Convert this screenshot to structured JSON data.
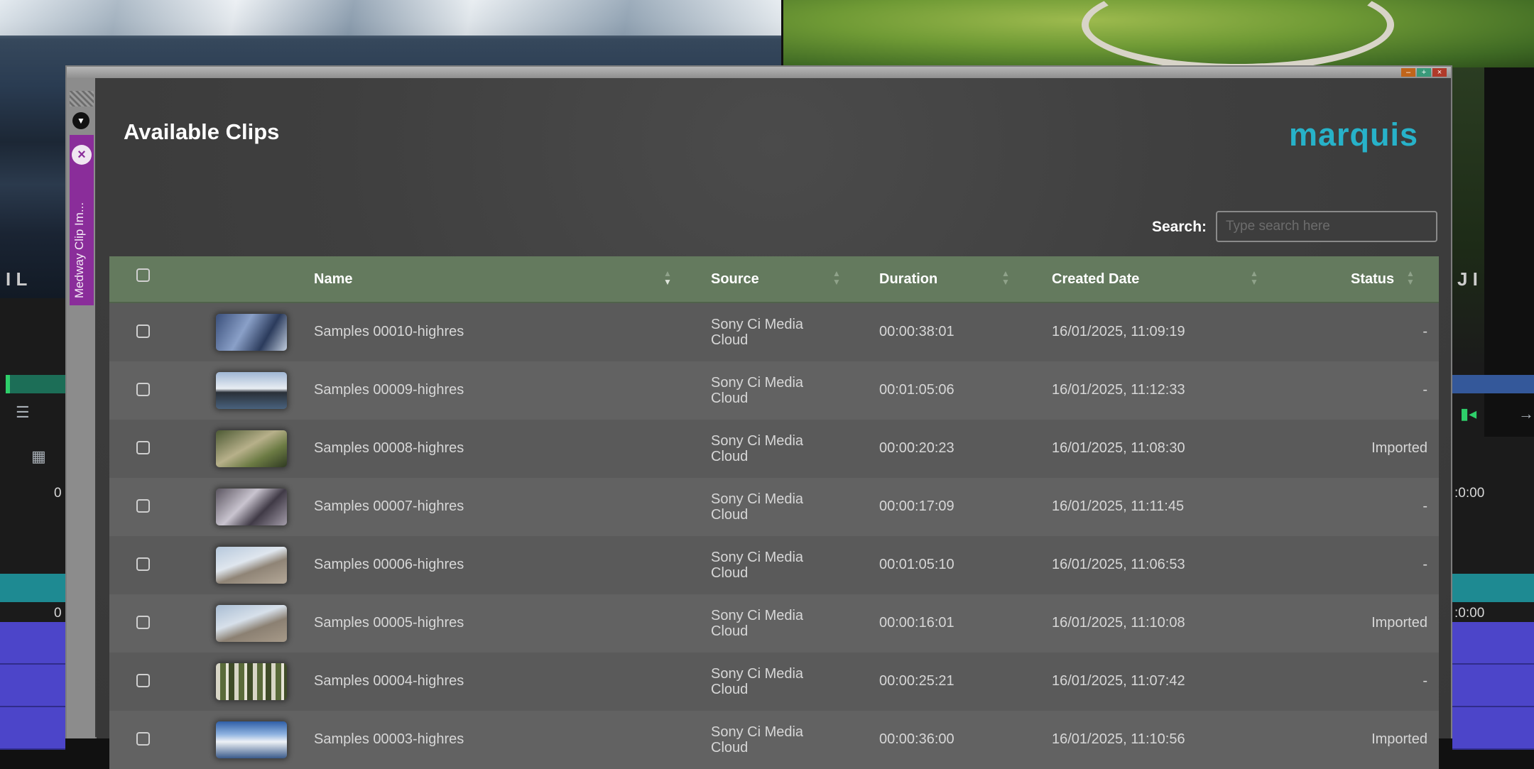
{
  "panel": {
    "title": "Available Clips",
    "logo": "marquis",
    "tab_label": "Medway Clip Im...",
    "search_label": "Search:",
    "search_placeholder": "Type search here",
    "search_value": ""
  },
  "columns": [
    "Name",
    "Source",
    "Duration",
    "Created Date",
    "Status"
  ],
  "rows": [
    {
      "name": "Samples 00010-highres",
      "source": [
        "Sony Ci Media",
        "Cloud"
      ],
      "duration": "00:00:38:01",
      "created": "16/01/2025, 11:09:19",
      "status": "-",
      "thumb": "linear-gradient(120deg,#3a4f7a,#8aa0c8 40%,#2b3b5c 70%,#c0ccdd)"
    },
    {
      "name": "Samples 00009-highres",
      "source": [
        "Sony Ci Media",
        "Cloud"
      ],
      "duration": "00:01:05:06",
      "created": "16/01/2025, 11:12:33",
      "status": "-",
      "thumb": "linear-gradient(180deg,#9fb6d4 0%,#e9eef3 45%,#2a3038 55%,#49627d 100%)"
    },
    {
      "name": "Samples 00008-highres",
      "source": [
        "Sony Ci Media",
        "Cloud"
      ],
      "duration": "00:00:20:23",
      "created": "16/01/2025, 11:08:30",
      "status": "Imported",
      "thumb": "linear-gradient(150deg,#4d5a34,#b7b08a 45%,#6b7a43 70%,#2f3a22)"
    },
    {
      "name": "Samples 00007-highres",
      "source": [
        "Sony Ci Media",
        "Cloud"
      ],
      "duration": "00:00:17:09",
      "created": "16/01/2025, 11:11:45",
      "status": "-",
      "thumb": "linear-gradient(135deg,#5b5560,#c9c4cf 40%,#403a46 65%,#a39ca9)"
    },
    {
      "name": "Samples 00006-highres",
      "source": [
        "Sony Ci Media",
        "Cloud"
      ],
      "duration": "00:01:05:10",
      "created": "16/01/2025, 11:06:53",
      "status": "-",
      "thumb": "linear-gradient(160deg,#b6c8dc 0%,#dfe6ee 40%,#8f8476 60%,#b4a898 100%)"
    },
    {
      "name": "Samples 00005-highres",
      "source": [
        "Sony Ci Media",
        "Cloud"
      ],
      "duration": "00:00:16:01",
      "created": "16/01/2025, 11:10:08",
      "status": "Imported",
      "thumb": "linear-gradient(160deg,#a9bdd3 0%,#d7e0ea 40%,#8b8072 62%,#a79a89 100%)"
    },
    {
      "name": "Samples 00004-highres",
      "source": [
        "Sony Ci Media",
        "Cloud"
      ],
      "duration": "00:00:25:21",
      "created": "16/01/2025, 11:07:42",
      "status": "-",
      "thumb": "repeating-linear-gradient(90deg,#d8d6c6 0 6px,#5a6b3a 6px 14px,#e6e4d6 14px 18px,#3f4c28 18px 26px)"
    },
    {
      "name": "Samples 00003-highres",
      "source": [
        "Sony Ci Media",
        "Cloud"
      ],
      "duration": "00:00:36:00",
      "created": "16/01/2025, 11:10:56",
      "status": "Imported",
      "thumb": "linear-gradient(180deg,#2f5fa8 0%,#8fb3e0 35%,#eef2f6 55%,#3a5a8a 100%)"
    }
  ],
  "background": {
    "timecodes_left": [
      "0",
      "0"
    ],
    "timecodes_right": [
      ":0:00",
      ":0:00"
    ]
  },
  "colors": {
    "accent": "#27b2c9",
    "header_bg": "#647a5e",
    "tab": "#8a2d9a"
  }
}
